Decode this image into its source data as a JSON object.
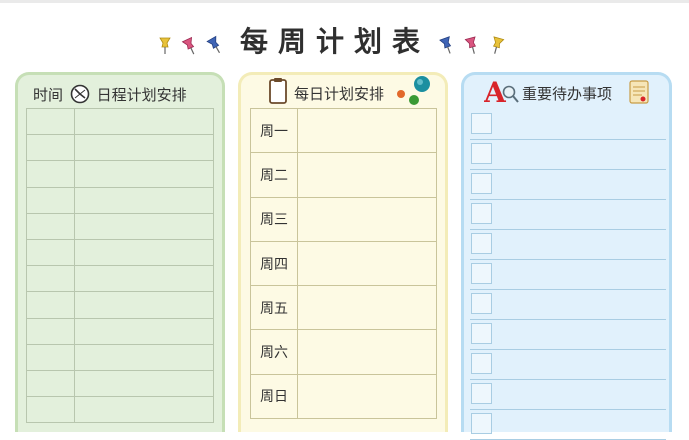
{
  "title": "每周计划表",
  "columns": {
    "schedule": {
      "header": "时间",
      "header_suffix": "日程计划安排",
      "row_count": 12
    },
    "daily": {
      "header": "每日计划安排",
      "days": [
        "周一",
        "周二",
        "周三",
        "周四",
        "周五",
        "周六",
        "周日"
      ]
    },
    "todo": {
      "header": "重要待办事项",
      "row_count": 11
    }
  },
  "colors": {
    "green_panel": "#e3f0dc",
    "yellow_panel": "#fdfae4",
    "blue_panel": "#e1f1fc",
    "pin_yellow": "#e8c23a",
    "pin_pink": "#d9557f",
    "pin_blue": "#3f64b5"
  },
  "icons": [
    "pushpin-icon",
    "clock-icon",
    "clipboard-icon",
    "magnet-icon",
    "letter-a-icon",
    "scroll-icon"
  ]
}
